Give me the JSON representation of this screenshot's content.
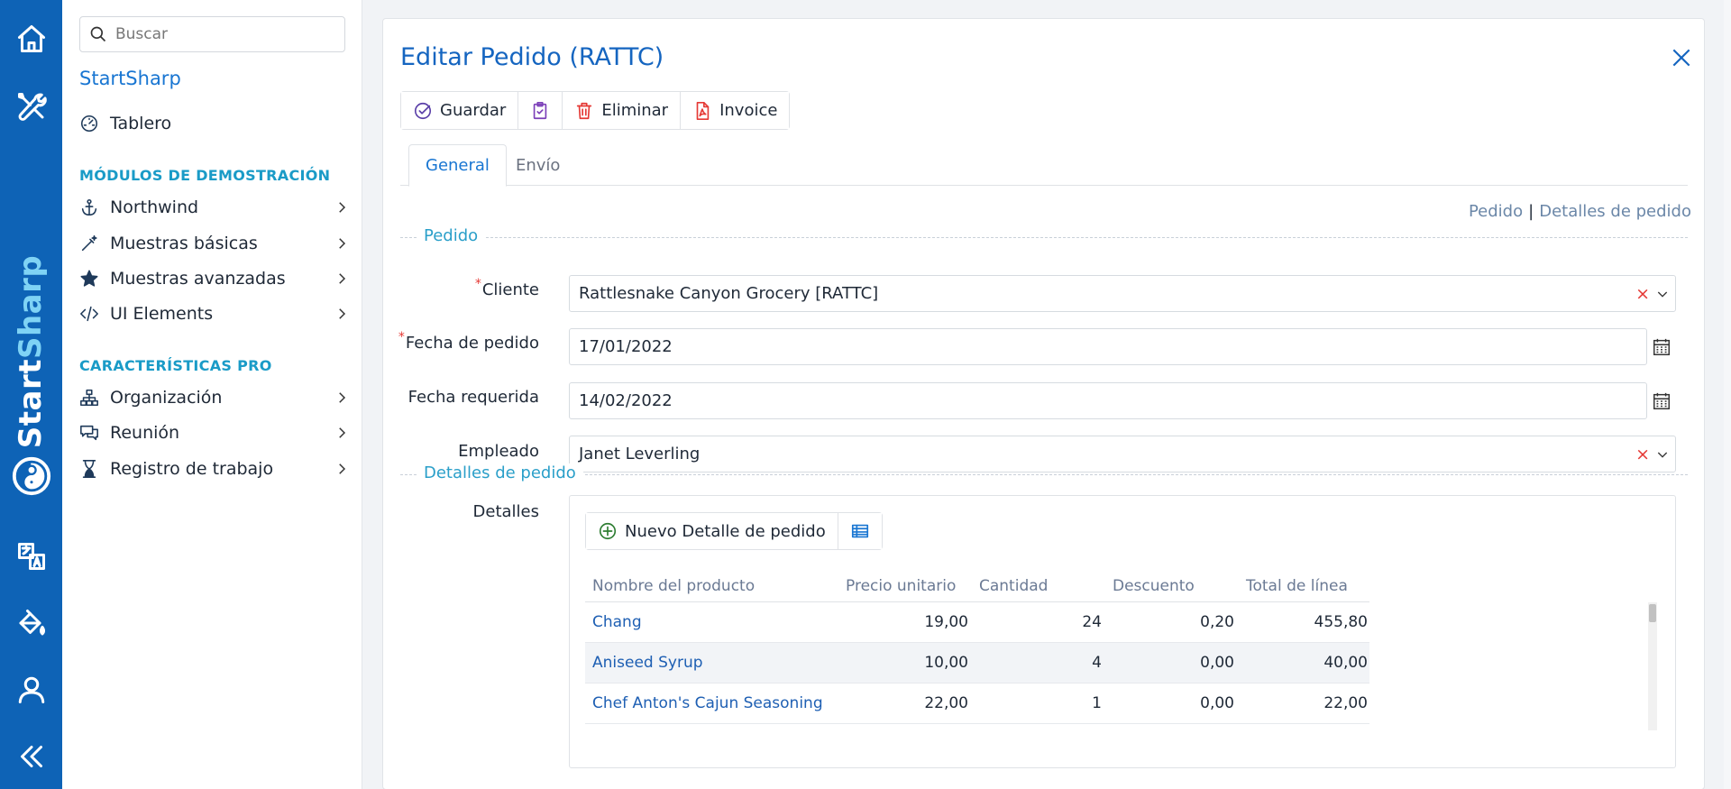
{
  "rail": {
    "brand_part1": "Start",
    "brand_part2": "Sharp",
    "icons": [
      "home-icon",
      "tools-icon",
      "translate-icon",
      "paint-bucket-icon",
      "user-icon",
      "collapse-icon"
    ]
  },
  "sidebar": {
    "search_placeholder": "Buscar",
    "title": "StartSharp",
    "dashboard": "Tablero",
    "section_demo": "MÓDULOS DE DEMOSTRACIÓN",
    "demo_items": [
      {
        "label": "Northwind",
        "icon": "anchor-icon"
      },
      {
        "label": "Muestras básicas",
        "icon": "magic-wand-icon"
      },
      {
        "label": "Muestras avanzadas",
        "icon": "star-icon"
      },
      {
        "label": "UI Elements",
        "icon": "code-icon"
      }
    ],
    "section_pro": "CARACTERÍSTICAS PRO",
    "pro_items": [
      {
        "label": "Organización",
        "icon": "org-chart-icon"
      },
      {
        "label": "Reunión",
        "icon": "chat-icon"
      },
      {
        "label": "Registro de trabajo",
        "icon": "hourglass-icon"
      }
    ]
  },
  "dialog": {
    "title": "Editar Pedido (RATTC)",
    "toolbar": {
      "save": "Guardar",
      "delete": "Eliminar",
      "invoice": "Invoice"
    },
    "tabs": [
      "General",
      "Envío"
    ],
    "active_tab": "General",
    "links": {
      "pedido": "Pedido",
      "separator": "|",
      "detalles": "Detalles de pedido"
    },
    "section_pedido": "Pedido",
    "fields": {
      "cliente_label": "Cliente",
      "cliente_value": "Rattlesnake Canyon Grocery [RATTC]",
      "fecha_pedido_label": "Fecha de pedido",
      "fecha_pedido_value": "17/01/2022",
      "fecha_requerida_label": "Fecha requerida",
      "fecha_requerida_value": "14/02/2022",
      "empleado_label": "Empleado",
      "empleado_value": "Janet Leverling"
    },
    "section_detalles": "Detalles de pedido",
    "detalles_label": "Detalles",
    "new_detail_button": "Nuevo Detalle de pedido",
    "grid": {
      "headers": [
        "Nombre del producto",
        "Precio unitario",
        "Cantidad",
        "Descuento",
        "Total de línea"
      ],
      "rows": [
        {
          "product": "Chang",
          "price": "19,00",
          "qty": "24",
          "discount": "0,20",
          "total": "455,80"
        },
        {
          "product": "Aniseed Syrup",
          "price": "10,00",
          "qty": "4",
          "discount": "0,00",
          "total": "40,00"
        },
        {
          "product": "Chef Anton's Cajun Seasoning",
          "price": "22,00",
          "qty": "1",
          "discount": "0,00",
          "total": "22,00"
        }
      ]
    }
  },
  "colors": {
    "rail": "#0e63b6",
    "accent": "#1976d2",
    "section": "#1a9bc7",
    "danger": "#e53935"
  }
}
